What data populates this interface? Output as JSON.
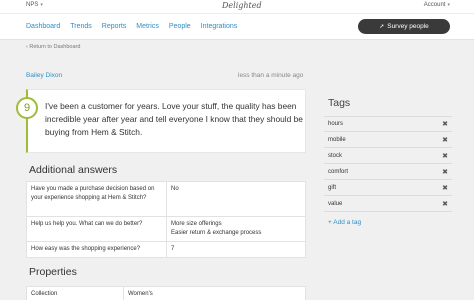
{
  "topbar": {
    "survey_select": "NPS",
    "logo": "Delighted",
    "account": "Account"
  },
  "nav": {
    "links": [
      "Dashboard",
      "Trends",
      "Reports",
      "Metrics",
      "People",
      "Integrations"
    ],
    "survey_button": "Survey people"
  },
  "back_link": "‹ Return to Dashboard",
  "response": {
    "name": "Bailey Dixon",
    "time": "less than a minute ago",
    "score": "9",
    "text": "I've been a customer for years. Love your stuff, the quality has been incredible year after year and tell everyone I know that they should be buying from Hem & Stitch."
  },
  "additional": {
    "title": "Additional answers",
    "rows": [
      {
        "question": "Have you made a purchase decision based on your experience shopping at Hem & Stitch?",
        "answer": "No"
      },
      {
        "question": "Help us help you. What can we do better?",
        "answer": "More size offerings\nEasier return & exchange process"
      },
      {
        "question": "How easy was the shopping experience?",
        "answer": "7"
      }
    ]
  },
  "properties": {
    "title": "Properties",
    "rows": [
      {
        "key": "Collection",
        "value": "Women's"
      }
    ]
  },
  "tags": {
    "title": "Tags",
    "items": [
      "hours",
      "mobile",
      "stock",
      "comfort",
      "gift",
      "value"
    ],
    "add_label": "+ Add a tag"
  },
  "colors": {
    "accent_blue": "#2f8fc6",
    "promoter_green": "#9dbd3a",
    "button_dark": "#3a3a3a"
  }
}
